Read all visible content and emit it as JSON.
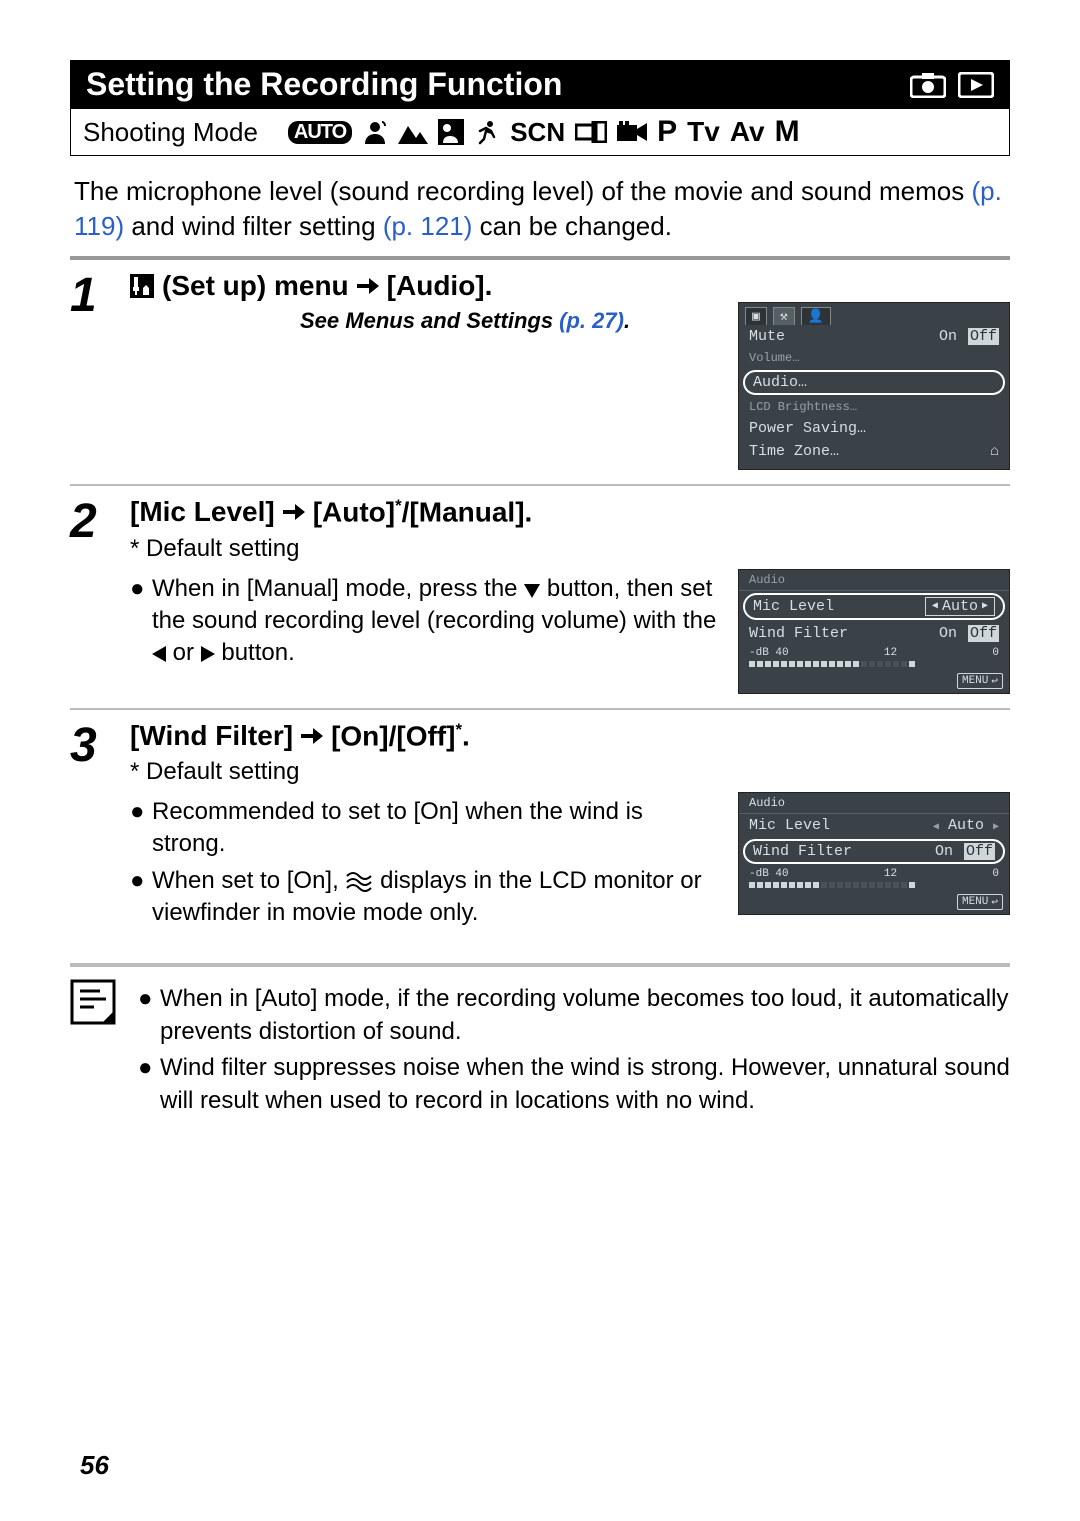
{
  "title": "Setting the Recording Function",
  "shooting_label": "Shooting Mode",
  "modes": {
    "auto_pill": "AUTO",
    "scn": "SCN",
    "p": "P",
    "tv": "Tv",
    "av": "Av",
    "m": "M"
  },
  "intro": {
    "t1": "The microphone level (sound recording level) of the movie and sound memos ",
    "ref1": "(p. 119)",
    "t2": " and wind filter setting ",
    "ref2": "(p. 121)",
    "t3": " can be changed."
  },
  "step1": {
    "num": "1",
    "title_a": "(Set up) menu",
    "title_b": "[Audio].",
    "subtitle_a": "See Menus and Settings ",
    "subtitle_ref": "(p. 27)",
    "subtitle_b": ".",
    "lcd": {
      "mute": "Mute",
      "mute_on": "On",
      "mute_off": "Off",
      "volume": "Volume…",
      "audio": "Audio…",
      "lcd_b": "LCD Brightness…",
      "power": "Power Saving…",
      "tz": "Time Zone…"
    }
  },
  "step2": {
    "num": "2",
    "title_a": "[Mic Level]",
    "title_b": "[Auto]",
    "title_c": "/[Manual].",
    "default": "* Default setting",
    "b1a": "When in [Manual] mode, press the ",
    "b1b": " button, then set the sound recording level (recording volume) with the ",
    "b1c": " or ",
    "b1d": " button.",
    "lcd": {
      "header": "Audio",
      "mic": "Mic Level",
      "mic_val": "Auto",
      "wf": "Wind Filter",
      "wf_on": "On",
      "wf_off": "Off",
      "meter_label_l": "-dB 40",
      "meter_label_m": "12",
      "meter_label_r": "0",
      "menu": "MENU"
    }
  },
  "step3": {
    "num": "3",
    "title_a": "[Wind Filter]",
    "title_b": "[On]/[Off]",
    "title_c": ".",
    "default": "* Default setting",
    "b1": "Recommended to set to [On] when the wind is strong.",
    "b2a": "When set to [On], ",
    "b2b": " displays in the LCD monitor or viewfinder in movie mode only.",
    "lcd": {
      "header": "Audio",
      "mic": "Mic Level",
      "mic_val": "Auto",
      "wf": "Wind Filter",
      "wf_on": "On",
      "wf_off": "Off",
      "meter_label_l": "-dB 40",
      "meter_label_m": "12",
      "meter_label_r": "0",
      "menu": "MENU"
    }
  },
  "footer": {
    "n1": "When in [Auto] mode, if the recording volume becomes too loud, it automatically prevents distortion of sound.",
    "n2": "Wind filter suppresses noise when the wind is strong. However, unnatural sound will result when used to record in locations with no wind."
  },
  "page_number": "56"
}
